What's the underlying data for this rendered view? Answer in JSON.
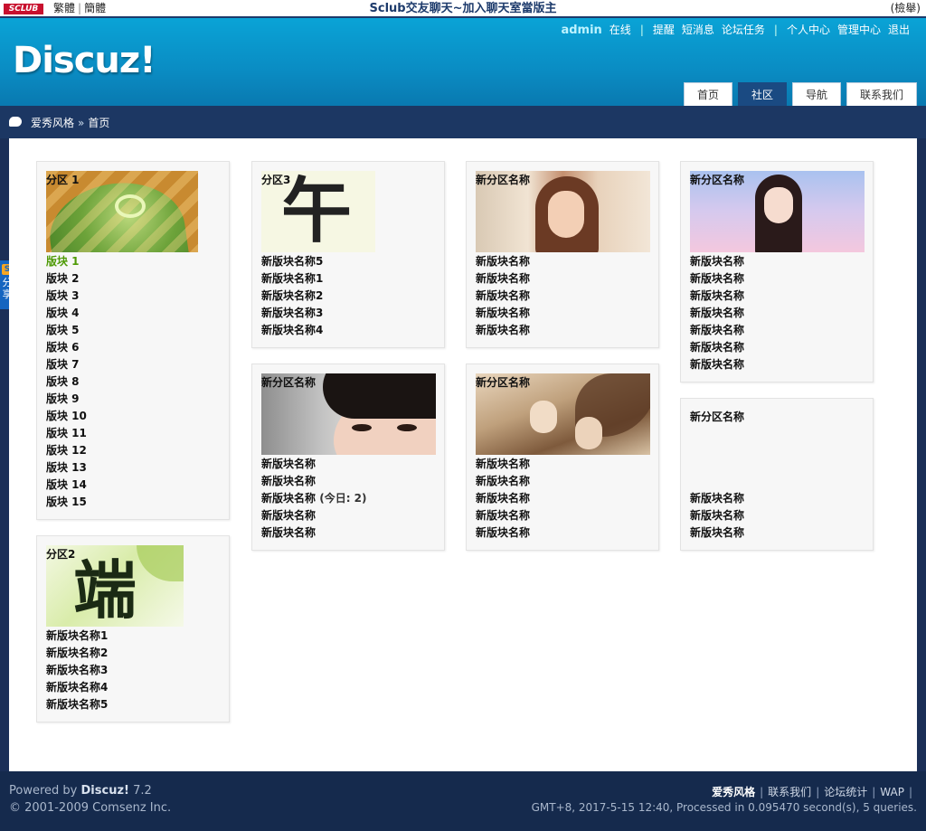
{
  "topbar": {
    "logo": "SCLUB",
    "lang": [
      "繁體",
      "簡體"
    ],
    "center": "Sclub交友聊天~加入聊天室當版主",
    "right": "(檢舉)"
  },
  "header": {
    "brand": "Discuz!",
    "username": "admin",
    "online": "在线",
    "links": [
      "提醒",
      "短消息",
      "论坛任务",
      "个人中心",
      "管理中心",
      "退出"
    ],
    "tabs": [
      "首页",
      "社区",
      "导航",
      "联系我们"
    ],
    "active_tab": "社区"
  },
  "breadcrumb": {
    "site": "爱秀风格",
    "arrow": "»",
    "current": "首页"
  },
  "share": {
    "label": "分享",
    "badge": "S"
  },
  "cards": [
    {
      "title": "分区 1",
      "items": [
        "版块 1",
        "版块 2",
        "版块 3",
        "版块 4",
        "版块 5",
        "版块 6",
        "版块 7",
        "版块 8",
        "版块 9",
        "版块 10",
        "版块 11",
        "版块 12",
        "版块 13",
        "版块 14",
        "版块 15"
      ]
    },
    {
      "title": "分区2",
      "items": [
        "新版块名称1",
        "新版块名称2",
        "新版块名称3",
        "新版块名称4",
        "新版块名称5"
      ]
    },
    {
      "title": "分区3",
      "items": [
        "新版块名称5",
        "新版块名称1",
        "新版块名称2",
        "新版块名称3",
        "新版块名称4"
      ]
    },
    {
      "title": "新分区名称",
      "items": [
        "新版块名称",
        "新版块名称",
        "新版块名称",
        "新版块名称",
        "新版块名称"
      ],
      "today_label": "(今日: 2)"
    },
    {
      "title": "新分区名称",
      "items": [
        "新版块名称",
        "新版块名称",
        "新版块名称",
        "新版块名称",
        "新版块名称"
      ]
    },
    {
      "title": "新分区名称",
      "items": [
        "新版块名称",
        "新版块名称",
        "新版块名称",
        "新版块名称",
        "新版块名称"
      ]
    },
    {
      "title": "新分区名称",
      "items": [
        "新版块名称",
        "新版块名称",
        "新版块名称",
        "新版块名称",
        "新版块名称",
        "新版块名称",
        "新版块名称"
      ]
    },
    {
      "title": "新分区名称",
      "items": [
        "新版块名称",
        "新版块名称",
        "新版块名称"
      ]
    }
  ],
  "footer": {
    "powered": "Powered by",
    "product": "Discuz!",
    "version": "7.2",
    "copyright": "© 2001-2009 Comsenz Inc.",
    "links": [
      "爱秀风格",
      "联系我们",
      "论坛统计",
      "WAP"
    ],
    "stats": "GMT+8, 2017-5-15 12:40, Processed in 0.095470 second(s), 5 queries."
  },
  "colors": {
    "header": "#0a8cc3",
    "crumb_bar": "#1c3763",
    "footer": "#152a4d",
    "highlight": "#4e9a06",
    "active_tab": "#1a4a82"
  }
}
